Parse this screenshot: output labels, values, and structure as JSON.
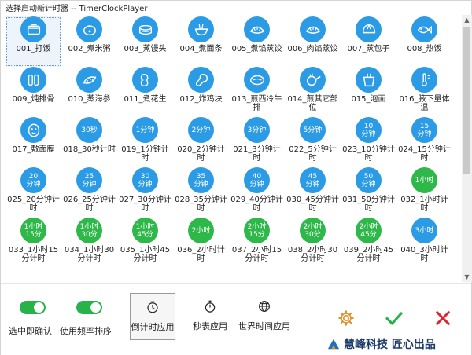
{
  "window": {
    "title": "选择启动新计时器 -- TimerClockPlayer"
  },
  "timers": [
    {
      "label": "001_打饭",
      "icon": "rice-box-icon"
    },
    {
      "label": "002_煮米粥",
      "icon": "rice-cooker-icon"
    },
    {
      "label": "003_蒸馒头",
      "icon": "steamer-icon"
    },
    {
      "label": "004_煮面条",
      "icon": "noodle-bowl-icon"
    },
    {
      "label": "005_煮馅蒸饺",
      "icon": "dumpling-icon"
    },
    {
      "label": "006_肉馅蒸饺",
      "icon": "dumpling-icon"
    },
    {
      "label": "007_蒸包子",
      "icon": "bun-icon"
    },
    {
      "label": "008_热饭",
      "icon": "fish-icon"
    },
    {
      "label": "009_炖排骨",
      "icon": "ribs-icon"
    },
    {
      "label": "010_蒸海参",
      "icon": "sea-cucumber-icon"
    },
    {
      "label": "011_煮花生",
      "icon": "peanut-icon"
    },
    {
      "label": "012_炸鸡块",
      "icon": "drumstick-icon"
    },
    {
      "label": "013_煎西冷牛排",
      "icon": "steak-icon"
    },
    {
      "label": "014_煎其它部位",
      "icon": "frying-pan-icon"
    },
    {
      "label": "015_泡面",
      "icon": "instant-noodle-icon"
    },
    {
      "label": "016_腋下量体温",
      "icon": "thermometer-icon"
    },
    {
      "label": "017_敷面膜",
      "icon": "face-mask-icon"
    },
    {
      "label": "018_30秒计时",
      "text": "30秒"
    },
    {
      "label": "019_1分钟计时",
      "text": "1分钟"
    },
    {
      "label": "020_2分钟计时",
      "text": "2分钟"
    },
    {
      "label": "021_3分钟计时",
      "text": "3分钟"
    },
    {
      "label": "022_5分钟计时",
      "text": "5分钟"
    },
    {
      "label": "023_10分钟计时",
      "text": "10\n分钟"
    },
    {
      "label": "024_15分钟计时",
      "text": "15\n分钟"
    },
    {
      "label": "025_20分钟计时",
      "text": "20\n分钟"
    },
    {
      "label": "026_25分钟计时",
      "text": "25\n分钟"
    },
    {
      "label": "027_30分钟计时",
      "text": "30\n分钟"
    },
    {
      "label": "028_35分钟计时",
      "text": "35\n分钟"
    },
    {
      "label": "029_40分钟计时",
      "text": "40\n分钟"
    },
    {
      "label": "030_45分钟计时",
      "text": "45\n分钟"
    },
    {
      "label": "031_50分钟计时",
      "text": "50\n分钟"
    },
    {
      "label": "032_1小时计时",
      "text": "1小时",
      "color": "green"
    },
    {
      "label": "033_1小时15分计时",
      "text": "1小时\n15分",
      "color": "green"
    },
    {
      "label": "034_1小时30分计时",
      "text": "1小时\n30分",
      "color": "green"
    },
    {
      "label": "035_1小时45分计时",
      "text": "1小时\n45分",
      "color": "green"
    },
    {
      "label": "036_2小时计时",
      "text": "2小时",
      "color": "green"
    },
    {
      "label": "037_2小时15分计时",
      "text": "2小时\n15分",
      "color": "green"
    },
    {
      "label": "038_2小时30分计时",
      "text": "2小时\n30分",
      "color": "green"
    },
    {
      "label": "039_2小时45分计时",
      "text": "2小时\n45分",
      "color": "green"
    },
    {
      "label": "040_3小时计时",
      "text": "3小时"
    }
  ],
  "options": {
    "confirm_on_select": "选中即确认",
    "sort_by_frequency": "使用频率排序"
  },
  "toolbar": {
    "countdown": "倒计时应用",
    "stopwatch": "秒表应用",
    "worldtime": "世界时间应用"
  },
  "colors": {
    "blue": "#2b9be6",
    "green": "#2fb84a",
    "confirm": "#27b34a",
    "cancel": "#e0262b",
    "settings": "#e0902a"
  },
  "brand": {
    "text": "慧峰科技 匠心出品"
  }
}
